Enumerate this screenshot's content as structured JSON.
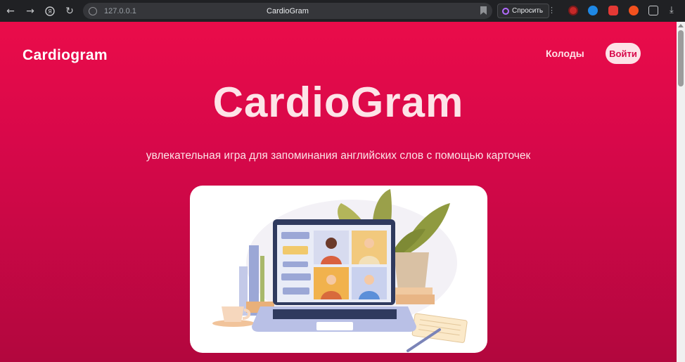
{
  "browser": {
    "url": "127.0.0.1",
    "tab_title": "CardioGram",
    "ask_label": "Спросить",
    "colors": {
      "chrome_bg": "#202124",
      "omnibox_bg": "#35363a"
    }
  },
  "header": {
    "logo": "Cardiogram",
    "nav_decks": "Колоды",
    "login_label": "Войти"
  },
  "hero": {
    "title": "CardioGram",
    "subtitle": "увлекательная игра для запоминания английских слов с помощью карточек"
  },
  "theme": {
    "gradient_top": "#ea0c4a",
    "gradient_bottom": "#b2073e",
    "text_light": "#fde4e8"
  }
}
